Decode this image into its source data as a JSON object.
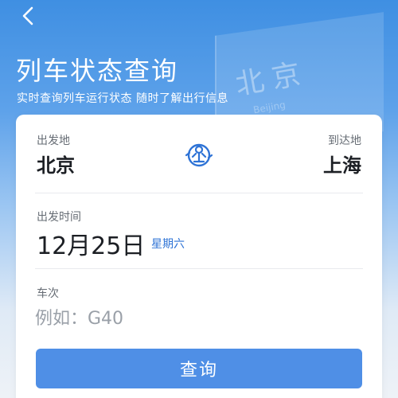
{
  "header": {
    "title": "列车状态查询",
    "subtitle": "实时查询列车运行状态 随时了解出行信息"
  },
  "background": {
    "sign_text": "北京",
    "sign_subtext": "Beijing"
  },
  "route": {
    "from_label": "出发地",
    "from_value": "北京",
    "to_label": "到达地",
    "to_value": "上海"
  },
  "departure": {
    "label": "出发时间",
    "date": "12月25日",
    "weekday": "星期六"
  },
  "train": {
    "label": "车次",
    "placeholder": "例如：G40"
  },
  "actions": {
    "query_label": "查询"
  },
  "colors": {
    "accent": "#4f8fe6",
    "link": "#2e73d6"
  },
  "icons": {
    "back": "chevron-left-icon",
    "swap": "railway-logo-icon"
  }
}
